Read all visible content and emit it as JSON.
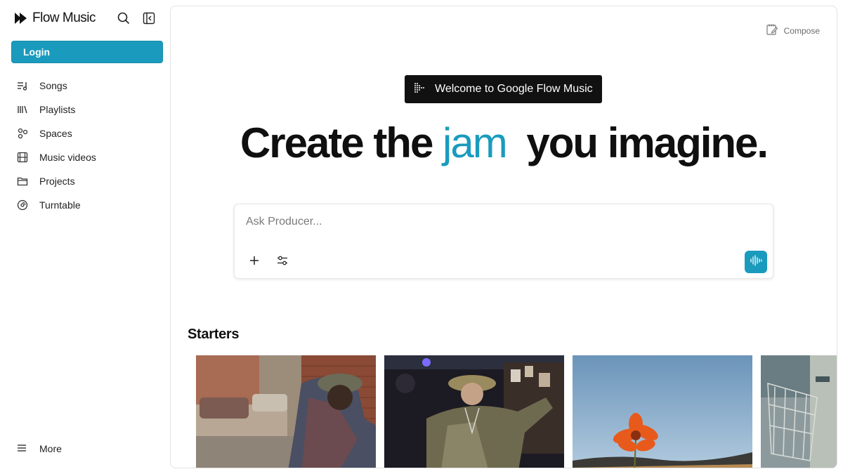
{
  "app": {
    "name": "Flow Music"
  },
  "sidebar": {
    "login_label": "Login",
    "items": [
      {
        "label": "Songs",
        "icon": "songs-icon"
      },
      {
        "label": "Playlists",
        "icon": "playlists-icon"
      },
      {
        "label": "Spaces",
        "icon": "spaces-icon"
      },
      {
        "label": "Music videos",
        "icon": "film-icon"
      },
      {
        "label": "Projects",
        "icon": "folder-icon"
      },
      {
        "label": "Turntable",
        "icon": "turntable-icon"
      }
    ],
    "more_label": "More"
  },
  "main": {
    "compose_label": "Compose",
    "welcome_label": "Welcome to Google Flow Music",
    "headline": {
      "before": "Create the",
      "accent": "jam",
      "after": "you imagine."
    },
    "prompt": {
      "placeholder": "Ask Producer..."
    },
    "starters_title": "Starters"
  },
  "colors": {
    "accent": "#1a9bbd",
    "welcome_bg": "#111111"
  }
}
